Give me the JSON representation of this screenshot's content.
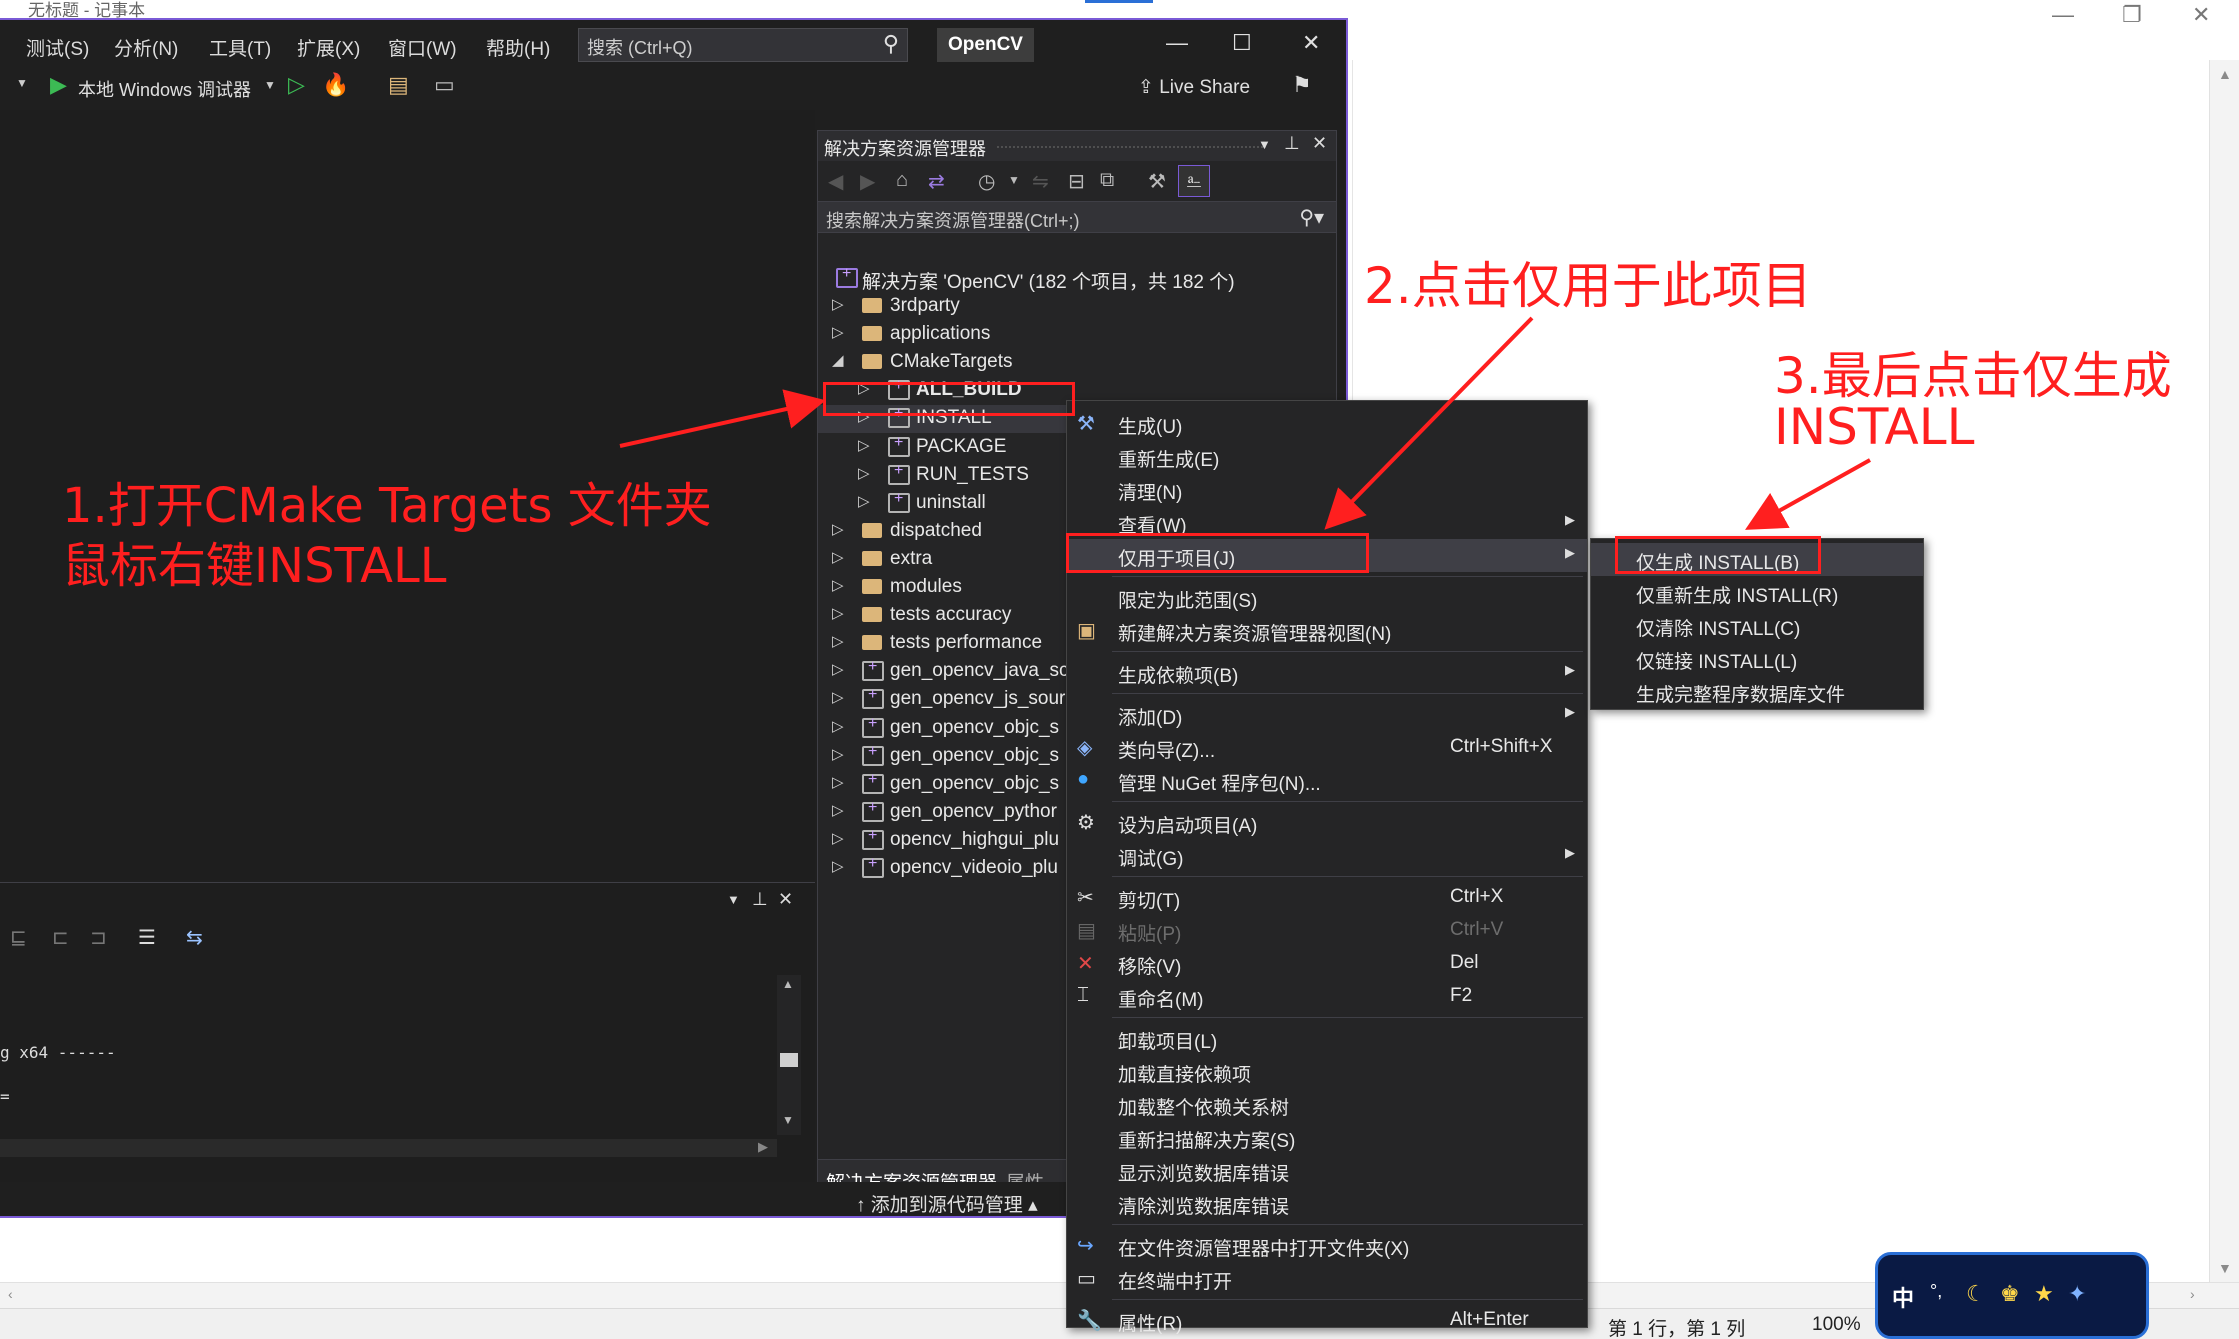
{
  "notepad": {
    "title": "无标题 - 记事本",
    "status": {
      "position": "第 1 行，第 1 列",
      "zoom": "100%"
    }
  },
  "vs": {
    "menu": [
      "测试(S)",
      "分析(N)",
      "工具(T)",
      "扩展(X)",
      "窗口(W)",
      "帮助(H)"
    ],
    "search_placeholder": "搜索 (Ctrl+Q)",
    "solution_name_badge": "OpenCV",
    "debugger_label": "本地 Windows 调试器",
    "live_share": "Live Share",
    "source_control": "添加到源代码管理"
  },
  "solution_explorer": {
    "title": "解决方案资源管理器",
    "search_placeholder": "搜索解决方案资源管理器(Ctrl+;)",
    "root": "解决方案 'OpenCV' (182 个项目，共 182 个)",
    "items": [
      {
        "label": "3rdparty",
        "type": "folder",
        "level": 0,
        "arrow": "▷"
      },
      {
        "label": "applications",
        "type": "folder",
        "level": 0,
        "arrow": "▷"
      },
      {
        "label": "CMakeTargets",
        "type": "folder",
        "level": 0,
        "arrow": "◢"
      },
      {
        "label": "ALL_BUILD",
        "type": "project",
        "level": 1,
        "arrow": "▷",
        "bold": true
      },
      {
        "label": "INSTALL",
        "type": "project",
        "level": 1,
        "arrow": "▷",
        "selected": true
      },
      {
        "label": "PACKAGE",
        "type": "project",
        "level": 1,
        "arrow": "▷"
      },
      {
        "label": "RUN_TESTS",
        "type": "project",
        "level": 1,
        "arrow": "▷"
      },
      {
        "label": "uninstall",
        "type": "project",
        "level": 1,
        "arrow": "▷"
      },
      {
        "label": "dispatched",
        "type": "folder",
        "level": 0,
        "arrow": "▷"
      },
      {
        "label": "extra",
        "type": "folder",
        "level": 0,
        "arrow": "▷"
      },
      {
        "label": "modules",
        "type": "folder",
        "level": 0,
        "arrow": "▷"
      },
      {
        "label": "tests accuracy",
        "type": "folder",
        "level": 0,
        "arrow": "▷"
      },
      {
        "label": "tests performance",
        "type": "folder",
        "level": 0,
        "arrow": "▷"
      },
      {
        "label": "gen_opencv_java_sc",
        "type": "project",
        "level": 0,
        "arrow": "▷"
      },
      {
        "label": "gen_opencv_js_sour",
        "type": "project",
        "level": 0,
        "arrow": "▷"
      },
      {
        "label": "gen_opencv_objc_s",
        "type": "project",
        "level": 0,
        "arrow": "▷"
      },
      {
        "label": "gen_opencv_objc_s",
        "type": "project",
        "level": 0,
        "arrow": "▷"
      },
      {
        "label": "gen_opencv_objc_s",
        "type": "project",
        "level": 0,
        "arrow": "▷"
      },
      {
        "label": "gen_opencv_pythor",
        "type": "project",
        "level": 0,
        "arrow": "▷"
      },
      {
        "label": "opencv_highgui_plu",
        "type": "project",
        "level": 0,
        "arrow": "▷"
      },
      {
        "label": "opencv_videoio_plu",
        "type": "project",
        "level": 0,
        "arrow": "▷"
      }
    ],
    "bottom_tabs": [
      "解决方案资源管理器",
      "属性"
    ]
  },
  "output": {
    "line1": "g x64 ------",
    "line2": "="
  },
  "context_menu": {
    "items": [
      {
        "label": "生成(U)",
        "icon": "build-icon"
      },
      {
        "label": "重新生成(E)"
      },
      {
        "label": "清理(N)"
      },
      {
        "label": "查看(W)",
        "submenu": true
      },
      {
        "label": "仅用于项目(J)",
        "submenu": true,
        "highlight": true
      },
      {
        "sep": true
      },
      {
        "label": "限定为此范围(S)"
      },
      {
        "label": "新建解决方案资源管理器视图(N)",
        "icon": "new-view-icon"
      },
      {
        "sep": true
      },
      {
        "label": "生成依赖项(B)",
        "submenu": true
      },
      {
        "sep": true
      },
      {
        "label": "添加(D)",
        "submenu": true
      },
      {
        "label": "类向导(Z)...",
        "shortcut": "Ctrl+Shift+X",
        "icon": "class-wizard-icon"
      },
      {
        "label": "管理 NuGet 程序包(N)...",
        "icon": "nuget-icon"
      },
      {
        "sep": true
      },
      {
        "label": "设为启动项目(A)",
        "icon": "gear-icon"
      },
      {
        "label": "调试(G)",
        "submenu": true
      },
      {
        "sep": true
      },
      {
        "label": "剪切(T)",
        "shortcut": "Ctrl+X",
        "icon": "cut-icon"
      },
      {
        "label": "粘贴(P)",
        "shortcut": "Ctrl+V",
        "icon": "paste-icon",
        "disabled": true
      },
      {
        "label": "移除(V)",
        "shortcut": "Del",
        "icon": "remove-icon"
      },
      {
        "label": "重命名(M)",
        "shortcut": "F2",
        "icon": "rename-icon"
      },
      {
        "sep": true
      },
      {
        "label": "卸载项目(L)"
      },
      {
        "label": "加载直接依赖项"
      },
      {
        "label": "加载整个依赖关系树"
      },
      {
        "label": "重新扫描解决方案(S)"
      },
      {
        "label": "显示浏览数据库错误"
      },
      {
        "label": "清除浏览数据库错误"
      },
      {
        "sep": true
      },
      {
        "label": "在文件资源管理器中打开文件夹(X)",
        "icon": "open-folder-icon"
      },
      {
        "label": "在终端中打开",
        "icon": "terminal-icon"
      },
      {
        "sep": true
      },
      {
        "label": "属性(R)",
        "shortcut": "Alt+Enter",
        "icon": "wrench-icon"
      }
    ]
  },
  "submenu": {
    "items": [
      {
        "label": "仅生成 INSTALL(B)",
        "highlight": true
      },
      {
        "label": "仅重新生成 INSTALL(R)"
      },
      {
        "label": "仅清除 INSTALL(C)"
      },
      {
        "label": "仅链接 INSTALL(L)"
      },
      {
        "label": "生成完整程序数据库文件"
      }
    ]
  },
  "annotations": {
    "step1_line1": "1.打开CMake Targets 文件夹",
    "step1_line2": "鼠标右键INSTALL",
    "step2": "2.点击仅用于此项目",
    "step3_line1": "3.最后点击仅生成",
    "step3_line2": "INSTALL",
    "color": "#ff1f1f"
  },
  "ime": {
    "label": "中"
  }
}
